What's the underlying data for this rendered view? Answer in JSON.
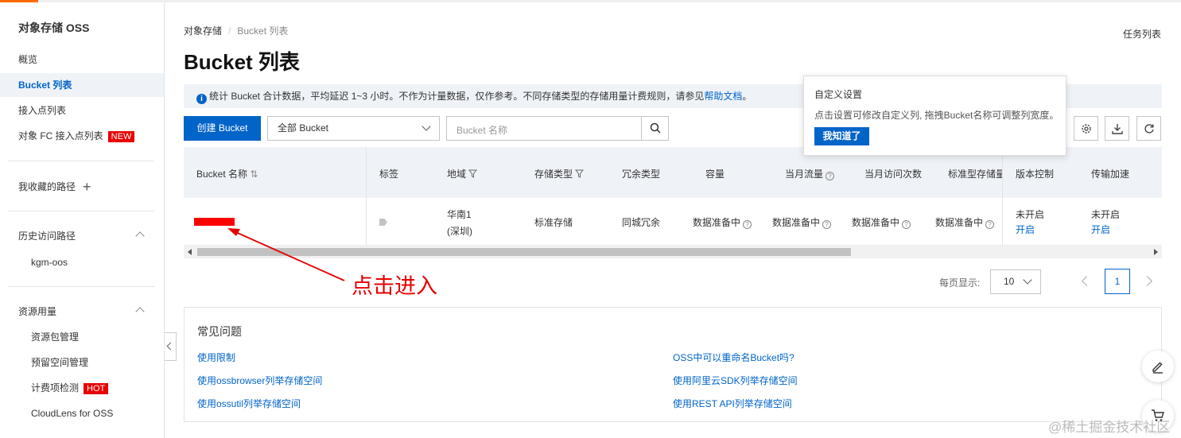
{
  "sidebar": {
    "title": "对象存储 OSS",
    "nav": [
      {
        "label": "概览"
      },
      {
        "label": "Bucket 列表"
      },
      {
        "label": "接入点列表"
      },
      {
        "label": "对象 FC 接入点列表",
        "badge": "NEW"
      }
    ],
    "favorites_label": "我收藏的路径",
    "history_label": "历史访问路径",
    "history_items": [
      "kgm-oos"
    ],
    "resources_label": "资源用量",
    "resource_items": [
      {
        "label": "资源包管理"
      },
      {
        "label": "预留空间管理"
      },
      {
        "label": "计费项检测",
        "badge": "HOT"
      },
      {
        "label": "CloudLens for OSS"
      }
    ]
  },
  "breadcrumb": [
    "对象存储",
    "Bucket 列表"
  ],
  "task_list_label": "任务列表",
  "page_title": "Bucket 列表",
  "notice": {
    "text": "统计 Bucket 合计数据，平均延迟 1~3 小时。不作为计量数据，仅作参考。不同存储类型的存储用量计费规则，请参见",
    "link": "帮助文档",
    "suffix": "。"
  },
  "toolbar": {
    "create_label": "创建 Bucket",
    "filter_value": "全部 Bucket",
    "search_placeholder": "Bucket 名称"
  },
  "popover": {
    "title": "自定义设置",
    "text": "点击设置可修改自定义列, 拖拽Bucket名称可调整列宽度。",
    "button": "我知道了"
  },
  "table": {
    "columns": [
      "Bucket 名称",
      "标签",
      "地域",
      "存储类型",
      "冗余类型",
      "容量",
      "当月流量",
      "当月访问次数",
      "标准型存储量",
      "版本控制",
      "传输加速"
    ],
    "rows": [
      {
        "region_line1": "华南1",
        "region_line2": "(深圳)",
        "storage_type": "标准存储",
        "redundancy": "同城冗余",
        "capacity": "数据准备中",
        "traffic": "数据准备中",
        "visits": "数据准备中",
        "standard_storage": "数据准备中",
        "versioning_status": "未开启",
        "versioning_action": "开启",
        "acceleration_status": "未开启",
        "acceleration_action": "开启"
      }
    ]
  },
  "annotation": "点击进入",
  "pagination": {
    "per_page_label": "每页显示:",
    "per_page_value": "10",
    "current_page": "1"
  },
  "faq": {
    "title": "常见问题",
    "links_left": [
      "使用限制",
      "使用ossbrowser列举存储空间",
      "使用ossutil列举存储空间"
    ],
    "links_right": [
      "OSS中可以重命名Bucket吗?",
      "使用阿里云SDK列举存储空间",
      "使用REST API列举存储空间"
    ]
  },
  "watermark": "@稀土掘金技术社区",
  "colors": {
    "primary": "#0064c8",
    "badge": "#e80000",
    "annotation": "#e60000",
    "header_bg": "#eff3f8"
  }
}
